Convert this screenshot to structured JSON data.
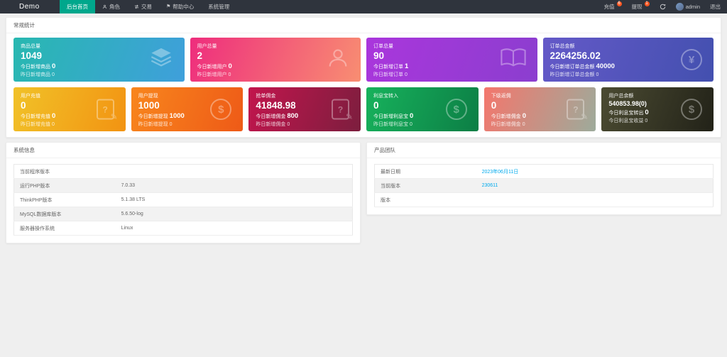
{
  "colors": {
    "navbar_bg": "#2F343D",
    "nav_active": "#00A78C",
    "badge": "#FF5722",
    "link": "#01AAED",
    "card_gradients": {
      "goods_total": [
        "#28B8B0",
        "#3F9FDB"
      ],
      "user_total": [
        "#EE2D7D",
        "#F88E72"
      ],
      "order_total": [
        "#AA36DC",
        "#8B3ECF"
      ],
      "order_amount": [
        "#6459C8",
        "#4350AF"
      ],
      "user_recharge": [
        "#F1C228",
        "#F29312"
      ],
      "user_withdraw": [
        "#F8861D",
        "#EE5A17"
      ],
      "order_commission": [
        "#C2154D",
        "#7C1E3E"
      ],
      "interest_in": [
        "#17B25C",
        "#0C7E45"
      ],
      "sub_rebate": [
        "#F4766C",
        "#9DAB9B"
      ],
      "user_balance": [
        "#4B4B32",
        "#222218"
      ]
    }
  },
  "navbar": {
    "brand": "Demo",
    "items": [
      {
        "label": "后台首页",
        "active": true
      },
      {
        "label": "角色",
        "icon": "user-icon"
      },
      {
        "label": "交易",
        "icon": "trade-icon"
      },
      {
        "label": "帮助中心",
        "icon": "flag-icon"
      },
      {
        "label": "系统管理",
        "icon": ""
      }
    ],
    "right": {
      "recharge_label": "充值",
      "recharge_badge": "6",
      "withdraw_label": "提现",
      "withdraw_badge": "1",
      "username": "admin",
      "logout_label": "退出"
    }
  },
  "stats": {
    "panel_title": "常规统计",
    "row1": [
      {
        "title": "商品总量",
        "value": "1049",
        "today_label": "今日新增商品",
        "today_value": "0",
        "yesterday_label": "昨日新增商品",
        "yesterday_value": "0",
        "icon": "layers-icon"
      },
      {
        "title": "用户总量",
        "value": "2",
        "today_label": "今日新增用户",
        "today_value": "0",
        "yesterday_label": "昨日新增用户",
        "yesterday_value": "0",
        "icon": "user-icon"
      },
      {
        "title": "订单总量",
        "value": "90",
        "today_label": "今日新增订单",
        "today_value": "1",
        "yesterday_label": "昨日新增订单",
        "yesterday_value": "0",
        "icon": "book-icon"
      },
      {
        "title": "订单总金额",
        "value": "2264256.02",
        "today_label": "今日新增订单总金额",
        "today_value": "40000",
        "yesterday_label": "昨日新增订单总金额",
        "yesterday_value": "0",
        "icon": "yen-icon"
      }
    ],
    "row2": [
      {
        "title": "用户充值",
        "value": "0",
        "today_label": "今日新增充值",
        "today_value": "0",
        "yesterday_label": "昨日新增充值",
        "yesterday_value": "0",
        "icon": "form-icon"
      },
      {
        "title": "用户提现",
        "value": "1000",
        "today_label": "今日新增提现",
        "today_value": "1000",
        "yesterday_label": "昨日新增提现",
        "yesterday_value": "0",
        "icon": "dollar-icon"
      },
      {
        "title": "抢单佣金",
        "value": "41848.98",
        "today_label": "今日新增佣金",
        "today_value": "800",
        "yesterday_label": "昨日新增佣金",
        "yesterday_value": "0",
        "icon": "form-icon"
      },
      {
        "title": "利息宝转入",
        "value": "0",
        "today_label": "今日新增利息宝",
        "today_value": "0",
        "yesterday_label": "昨日新增利息宝",
        "yesterday_value": "0",
        "icon": "dollar-icon"
      },
      {
        "title": "下级返佣",
        "value": "0",
        "today_label": "今日新增佣金",
        "today_value": "0",
        "yesterday_label": "昨日新增佣金",
        "yesterday_value": "0",
        "icon": "form-icon"
      },
      {
        "title": "用户总余额",
        "value": "540853.98(0)",
        "today_label": "今日利息宝转出",
        "today_value": "0",
        "yesterday_label": "今日利息宝收益",
        "yesterday_value": "0",
        "icon": "dollar-icon"
      }
    ]
  },
  "system_info": {
    "panel_title": "系统信息",
    "rows": [
      {
        "label": "当前程序版本",
        "value": ""
      },
      {
        "label": "运行PHP版本",
        "value": "7.0.33"
      },
      {
        "label": "ThinkPHP版本",
        "value": "5.1.38 LTS"
      },
      {
        "label": "MySQL数据库版本",
        "value": "5.6.50-log"
      },
      {
        "label": "服务器操作系统",
        "value": "Linux"
      }
    ]
  },
  "product_team": {
    "panel_title": "产品团队",
    "rows": [
      {
        "label": "最新日期",
        "value": "2023年06月11日"
      },
      {
        "label": "当前版本",
        "value": "230611"
      },
      {
        "label": "版本",
        "value": ""
      }
    ]
  }
}
